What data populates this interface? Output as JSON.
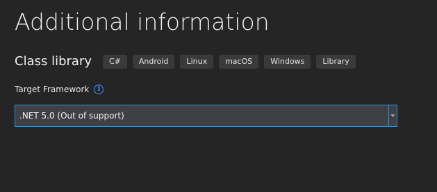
{
  "page": {
    "title": "Additional information"
  },
  "template": {
    "name": "Class library",
    "tags": [
      "C#",
      "Android",
      "Linux",
      "macOS",
      "Windows",
      "Library"
    ]
  },
  "framework": {
    "label": "Target Framework",
    "info_icon": "info-icon",
    "selected": ".NET 5.0 (Out of support)",
    "dropdown_icon": "chevron-down-icon"
  },
  "colors": {
    "background": "#252526",
    "accent": "#1c97ea",
    "tag_background": "#3a3a3b",
    "select_background": "#3f3f46"
  }
}
